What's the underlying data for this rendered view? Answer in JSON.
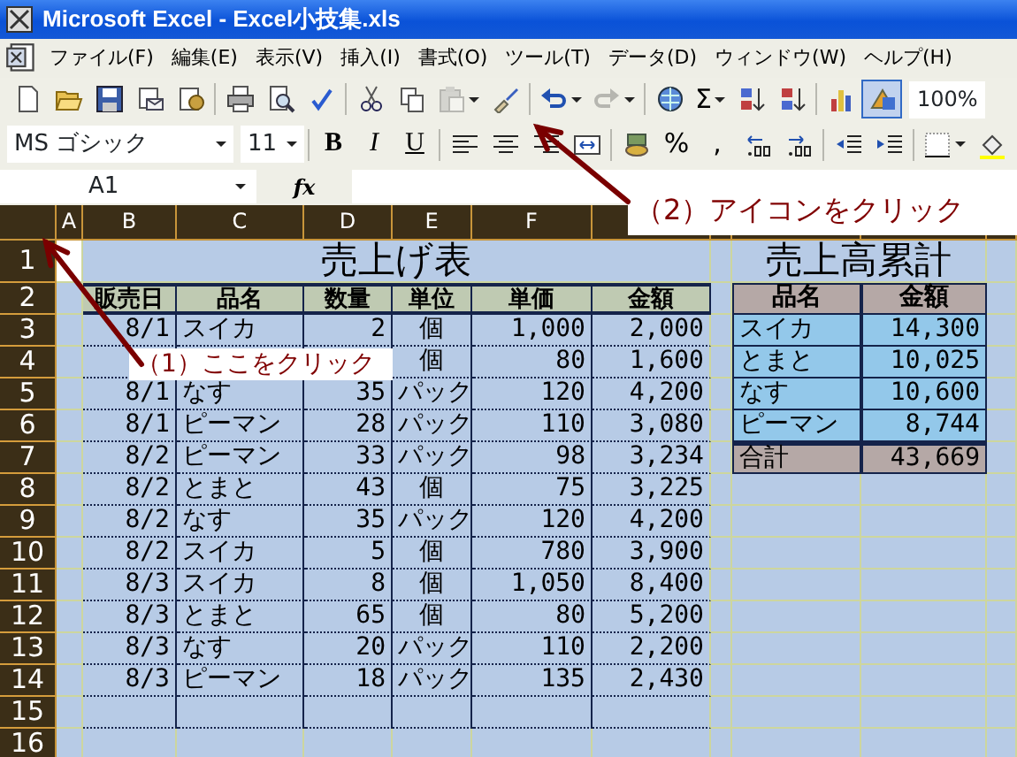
{
  "window": {
    "title": "Microsoft Excel - Excel小技集.xls"
  },
  "menu": [
    "ファイル(F)",
    "編集(E)",
    "表示(V)",
    "挿入(I)",
    "書式(O)",
    "ツール(T)",
    "データ(D)",
    "ウィンドウ(W)",
    "ヘルプ(H)"
  ],
  "standard_toolbar": {
    "groups": [
      [
        {
          "kind": "new",
          "disabled": false,
          "pressed": false,
          "dropdown": false
        },
        {
          "kind": "open",
          "disabled": false,
          "pressed": false,
          "dropdown": false
        },
        {
          "kind": "save",
          "disabled": false,
          "pressed": false,
          "dropdown": false
        },
        {
          "kind": "mail",
          "disabled": false,
          "pressed": false,
          "dropdown": false
        },
        {
          "kind": "permission",
          "disabled": false,
          "pressed": false,
          "dropdown": false
        }
      ],
      [
        {
          "kind": "print",
          "disabled": false,
          "pressed": false,
          "dropdown": false
        },
        {
          "kind": "preview",
          "disabled": false,
          "pressed": false,
          "dropdown": false
        },
        {
          "kind": "spelling",
          "disabled": false,
          "pressed": false,
          "dropdown": false
        }
      ],
      [
        {
          "kind": "cut",
          "disabled": false,
          "pressed": false,
          "dropdown": false
        },
        {
          "kind": "copy",
          "disabled": false,
          "pressed": false,
          "dropdown": false
        },
        {
          "kind": "paste",
          "disabled": true,
          "pressed": false,
          "dropdown": true
        },
        {
          "kind": "format_painter",
          "disabled": false,
          "pressed": false,
          "dropdown": false
        }
      ],
      [
        {
          "kind": "undo",
          "disabled": false,
          "pressed": false,
          "dropdown": true
        },
        {
          "kind": "redo",
          "disabled": true,
          "pressed": false,
          "dropdown": true
        }
      ],
      [
        {
          "kind": "hyperlink",
          "disabled": false,
          "pressed": false,
          "dropdown": false
        },
        {
          "kind": "text",
          "text": "Σ",
          "disabled": false,
          "pressed": false,
          "dropdown": true
        },
        {
          "kind": "sort_asc",
          "disabled": false,
          "pressed": false,
          "dropdown": false
        },
        {
          "kind": "sort_desc",
          "disabled": false,
          "pressed": false,
          "dropdown": false
        }
      ],
      [
        {
          "kind": "chart",
          "disabled": false,
          "pressed": false,
          "dropdown": false
        },
        {
          "kind": "drawing",
          "disabled": false,
          "pressed": true,
          "dropdown": false
        }
      ]
    ],
    "zoom": "100%"
  },
  "formatting_toolbar": {
    "font": "MS ゴシック",
    "size": "11",
    "groups": [
      [
        {
          "kind": "bold",
          "text": "B",
          "disabled": false,
          "pressed": false,
          "dropdown": false
        },
        {
          "kind": "italic",
          "text": "I",
          "disabled": false,
          "pressed": false,
          "dropdown": false
        },
        {
          "kind": "underline",
          "text": "U",
          "disabled": false,
          "pressed": false,
          "dropdown": false
        }
      ],
      [
        {
          "kind": "align_left",
          "disabled": false,
          "pressed": false,
          "dropdown": false
        },
        {
          "kind": "align_center",
          "disabled": false,
          "pressed": false,
          "dropdown": false
        },
        {
          "kind": "align_right",
          "disabled": false,
          "pressed": false,
          "dropdown": false
        },
        {
          "kind": "merge",
          "disabled": false,
          "pressed": false,
          "dropdown": false
        }
      ],
      [
        {
          "kind": "currency",
          "disabled": false,
          "pressed": false,
          "dropdown": false
        },
        {
          "kind": "text",
          "text": "%",
          "disabled": false,
          "pressed": false,
          "dropdown": false
        },
        {
          "kind": "text",
          "text": ",",
          "disabled": false,
          "pressed": false,
          "dropdown": false
        },
        {
          "kind": "increase_decimal",
          "disabled": false,
          "pressed": false,
          "dropdown": false
        },
        {
          "kind": "decrease_decimal",
          "disabled": false,
          "pressed": false,
          "dropdown": false
        }
      ],
      [
        {
          "kind": "outdent",
          "disabled": false,
          "pressed": false,
          "dropdown": false
        },
        {
          "kind": "indent",
          "disabled": false,
          "pressed": false,
          "dropdown": false
        }
      ],
      [
        {
          "kind": "borders",
          "disabled": false,
          "pressed": false,
          "dropdown": true
        },
        {
          "kind": "fill_color",
          "disabled": false,
          "pressed": false,
          "dropdown": false
        }
      ]
    ]
  },
  "formula_bar": {
    "name_box": "A1",
    "fx": "fx"
  },
  "sheet": {
    "column_headers": [
      "A",
      "B",
      "C",
      "D",
      "E",
      "F"
    ],
    "rows": [
      {
        "header": "1",
        "a_cell_selected": true
      },
      {
        "header": "2",
        "a_cell_selected": false
      },
      {
        "header": "3",
        "a_cell_selected": false
      },
      {
        "header": "4",
        "a_cell_selected": false
      },
      {
        "header": "5",
        "a_cell_selected": false
      },
      {
        "header": "6",
        "a_cell_selected": false
      },
      {
        "header": "7",
        "a_cell_selected": false
      },
      {
        "header": "8",
        "a_cell_selected": false
      },
      {
        "header": "9",
        "a_cell_selected": false
      },
      {
        "header": "10",
        "a_cell_selected": false
      },
      {
        "header": "11",
        "a_cell_selected": false
      },
      {
        "header": "12",
        "a_cell_selected": false
      },
      {
        "header": "13",
        "a_cell_selected": false
      },
      {
        "header": "14",
        "a_cell_selected": false
      },
      {
        "header": "15",
        "a_cell_selected": false
      },
      {
        "header": "16",
        "a_cell_selected": false
      }
    ]
  },
  "sales_table": {
    "title": "売上げ表",
    "columns": [
      "販売日",
      "品名",
      "数量",
      "単位",
      "単価",
      "金額"
    ],
    "rows": [
      [
        "8/1",
        "スイカ",
        "2",
        "個",
        "1,000",
        "2,000"
      ],
      [
        null,
        null,
        null,
        "個",
        "80",
        "1,600"
      ],
      [
        "8/1",
        "なす",
        "35",
        "パック",
        "120",
        "4,200"
      ],
      [
        "8/1",
        "ピーマン",
        "28",
        "パック",
        "110",
        "3,080"
      ],
      [
        "8/2",
        "ピーマン",
        "33",
        "パック",
        "98",
        "3,234"
      ],
      [
        "8/2",
        "とまと",
        "43",
        "個",
        "75",
        "3,225"
      ],
      [
        "8/2",
        "なす",
        "35",
        "パック",
        "120",
        "4,200"
      ],
      [
        "8/2",
        "スイカ",
        "5",
        "個",
        "780",
        "3,900"
      ],
      [
        "8/3",
        "スイカ",
        "8",
        "個",
        "1,050",
        "8,400"
      ],
      [
        "8/3",
        "とまと",
        "65",
        "個",
        "80",
        "5,200"
      ],
      [
        "8/3",
        "なす",
        "20",
        "パック",
        "110",
        "2,200"
      ],
      [
        "8/3",
        "ピーマン",
        "18",
        "パック",
        "135",
        "2,430"
      ]
    ]
  },
  "summary_table": {
    "title": "売上高累計",
    "columns": [
      "品名",
      "金額"
    ],
    "rows": [
      {
        "kind": "item",
        "cells": [
          "スイカ",
          "14,300"
        ]
      },
      {
        "kind": "item",
        "cells": [
          "とまと",
          "10,025"
        ]
      },
      {
        "kind": "item",
        "cells": [
          "なす",
          "10,600"
        ]
      },
      {
        "kind": "item",
        "cells": [
          "ピーマン",
          "8,744"
        ]
      },
      {
        "kind": "total",
        "cells": [
          "合計",
          "43,669"
        ]
      }
    ]
  },
  "callouts": [
    {
      "text": "（1）ここをクリック"
    },
    {
      "text": "（2）アイコンをクリック"
    }
  ]
}
